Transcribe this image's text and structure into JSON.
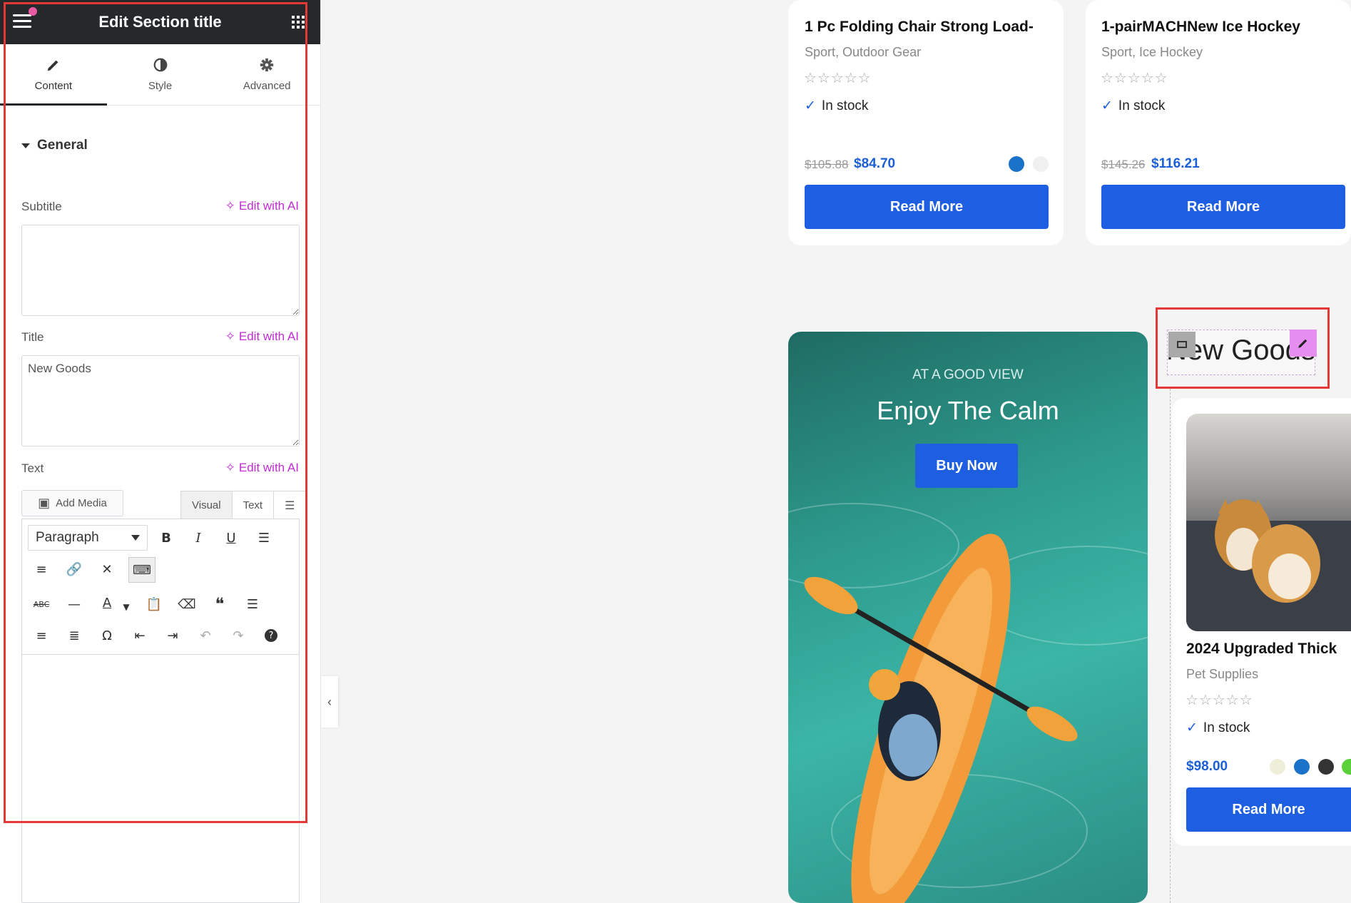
{
  "panel": {
    "title": "Edit Section title",
    "tabs": [
      {
        "label": "Content",
        "icon": "pencil-icon"
      },
      {
        "label": "Style",
        "icon": "contrast-icon"
      },
      {
        "label": "Advanced",
        "icon": "gear-icon"
      }
    ],
    "section": "General",
    "ai_label": "Edit with AI",
    "subtitle": {
      "label": "Subtitle",
      "value": ""
    },
    "title_field": {
      "label": "Title",
      "value": "New Goods"
    },
    "text": {
      "label": "Text",
      "add_media": "Add Media",
      "visual": "Visual",
      "text_tab": "Text",
      "format": "Paragraph",
      "value": ""
    }
  },
  "products": [
    {
      "title": "1 Pc Folding Chair Strong Load-",
      "category": "Sport, Outdoor Gear",
      "stars": "☆☆☆☆☆",
      "stock": "In stock",
      "old_price": "$105.88",
      "price": "$84.70",
      "button": "Read More",
      "swatches": [
        "#1a73c9",
        "#f0f0f0"
      ]
    },
    {
      "title": "1-pairMACHNew Ice Hockey",
      "category": "Sport, Ice Hockey",
      "stars": "☆☆☆☆☆",
      "stock": "In stock",
      "old_price": "$145.26",
      "price": "$116.21",
      "button": "Read More"
    },
    {
      "title": "2024 Upgraded Thick",
      "category": "Pet Supplies",
      "stars": "☆☆☆☆☆",
      "stock": "In stock",
      "price": "$98.00",
      "button": "Read More",
      "swatches": [
        "#eeeed9",
        "#1a73c9",
        "#333333",
        "#5ad13b"
      ]
    }
  ],
  "banner": {
    "eyebrow": "AT A GOOD VIEW",
    "title": "Enjoy The Calm",
    "button": "Buy Now"
  },
  "section_title": {
    "text": "New Goods"
  },
  "colors": {
    "accent": "#1d5fe0",
    "ai": "#c32cd6",
    "highlight": "#e53935"
  }
}
